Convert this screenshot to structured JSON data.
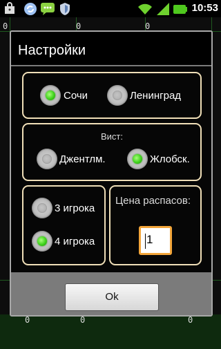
{
  "status_bar": {
    "time": "10:53",
    "icons": [
      "shopping-bag-icon",
      "sync-icon",
      "chat-icon",
      "shield-icon",
      "wifi-icon",
      "signal-icon",
      "battery-icon"
    ]
  },
  "background": {
    "numbers_top": [
      "0",
      "0",
      "0"
    ],
    "numbers_bottom": [
      "0",
      "0",
      "0"
    ]
  },
  "dialog": {
    "title": "Настройки",
    "rules": {
      "options": [
        {
          "label": "Сочи",
          "selected": true
        },
        {
          "label": "Ленинград",
          "selected": false
        }
      ]
    },
    "whist": {
      "title": "Вист:",
      "options": [
        {
          "label": "Джентлм.",
          "selected": false
        },
        {
          "label": "Жлобск.",
          "selected": true
        }
      ]
    },
    "players": {
      "options": [
        {
          "label": "3 игрока",
          "selected": false
        },
        {
          "label": "4 игрока",
          "selected": true
        }
      ]
    },
    "price": {
      "label": "Цена распасов:",
      "value": "1"
    },
    "ok_label": "Ok"
  },
  "colors": {
    "group_border": "#f0dfb8",
    "radio_on": "#3fd21c",
    "input_focus": "#f2a53a",
    "grid_line": "#1f5a1f"
  }
}
